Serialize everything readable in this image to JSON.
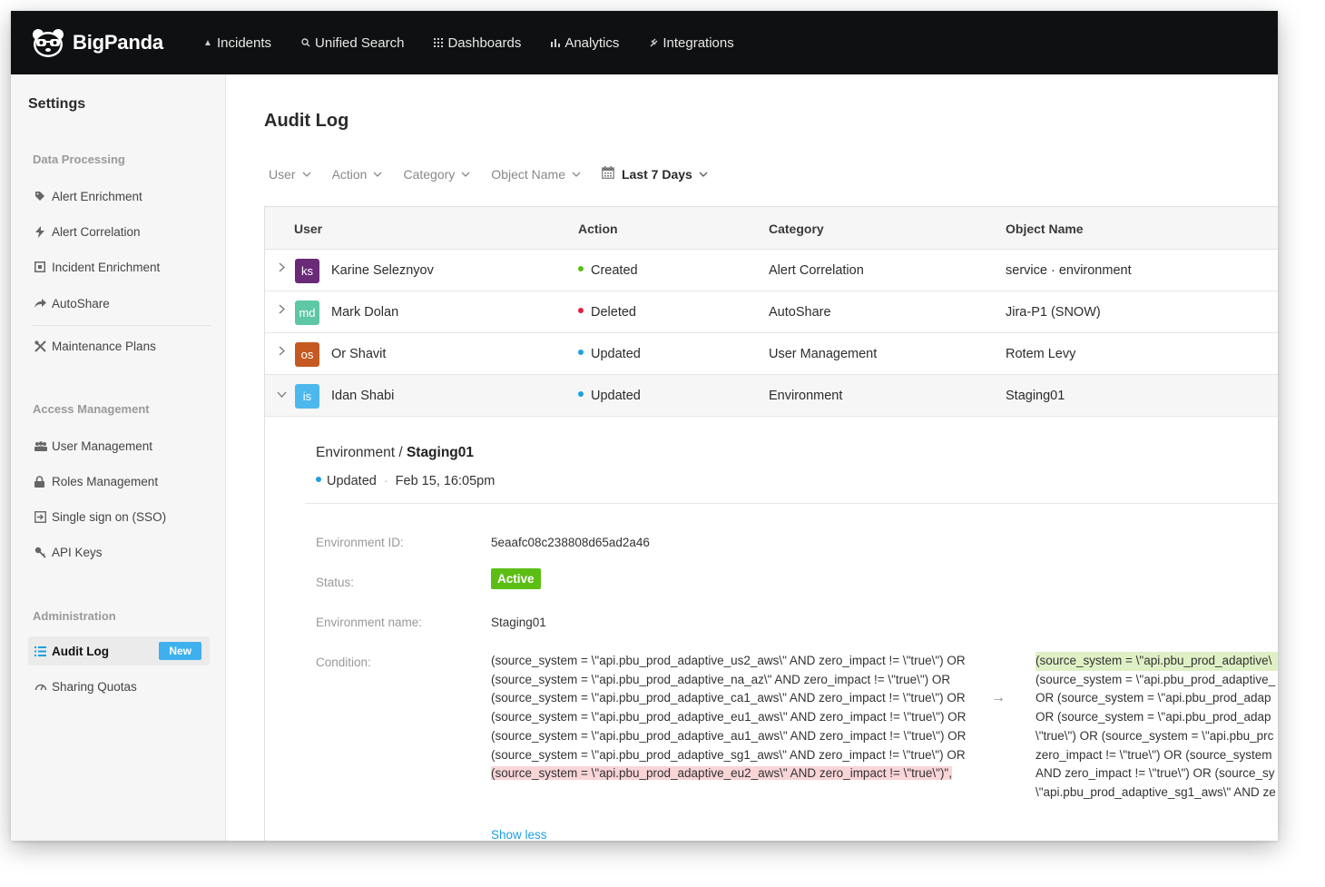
{
  "app": {
    "brand": "BigPanda"
  },
  "nav": [
    {
      "label": "Incidents",
      "icon": "triangle-icon"
    },
    {
      "label": "Unified Search",
      "icon": "search-icon"
    },
    {
      "label": "Dashboards",
      "icon": "grid-icon"
    },
    {
      "label": "Analytics",
      "icon": "bar-chart-icon"
    },
    {
      "label": "Integrations",
      "icon": "plug-icon"
    }
  ],
  "sidebar": {
    "title": "Settings",
    "sections": [
      {
        "label": "Data Processing",
        "items": [
          {
            "label": "Alert Enrichment",
            "icon": "tag-icon"
          },
          {
            "label": "Alert Correlation",
            "icon": "bolt-icon"
          },
          {
            "label": "Incident Enrichment",
            "icon": "square-dot-icon"
          },
          {
            "label": "AutoShare",
            "icon": "share-arrow-icon"
          },
          {
            "label": "Maintenance Plans",
            "icon": "tools-icon"
          }
        ]
      },
      {
        "label": "Access Management",
        "items": [
          {
            "label": "User Management",
            "icon": "users-icon"
          },
          {
            "label": "Roles Management",
            "icon": "lock-icon"
          },
          {
            "label": "Single sign on (SSO)",
            "icon": "sign-in-icon"
          },
          {
            "label": "API Keys",
            "icon": "key-icon"
          }
        ]
      },
      {
        "label": "Administration",
        "items": [
          {
            "label": "Audit Log",
            "icon": "list-icon",
            "active": true,
            "badge": "New"
          },
          {
            "label": "Sharing Quotas",
            "icon": "gauge-icon"
          }
        ]
      }
    ]
  },
  "page": {
    "title": "Audit Log"
  },
  "filters": {
    "user": "User",
    "action": "Action",
    "category": "Category",
    "object_name": "Object Name",
    "date": "Last 7 Days"
  },
  "table": {
    "columns": [
      "User",
      "Action",
      "Category",
      "Object Name"
    ],
    "rows": [
      {
        "initials": "ks",
        "avatar_color": "#6b2a78",
        "user": "Karine Seleznyov",
        "action": "Created",
        "action_color": "#5cbe15",
        "category": "Alert Correlation",
        "object": "service · environment"
      },
      {
        "initials": "md",
        "avatar_color": "#5dc7a6",
        "user": "Mark Dolan",
        "action": "Deleted",
        "action_color": "#e0213f",
        "category": "AutoShare",
        "object": "Jira-P1 (SNOW)"
      },
      {
        "initials": "os",
        "avatar_color": "#c45a22",
        "user": "Or Shavit",
        "action": "Updated",
        "action_color": "#1e9fe3",
        "category": "User Management",
        "object": "Rotem Levy"
      },
      {
        "initials": "is",
        "avatar_color": "#4cb8ee",
        "user": "Idan Shabi",
        "action": "Updated",
        "action_color": "#1e9fe3",
        "category": "Environment",
        "object": "Staging01"
      }
    ]
  },
  "detail": {
    "category": "Environment / ",
    "object": "Staging01",
    "action": "Updated",
    "date": "Feb 15, 16:05pm",
    "fields": {
      "env_id_label": "Environment ID:",
      "env_id": "5eaafc08c238808d65ad2a46",
      "status_label": "Status:",
      "status": "Active",
      "name_label": "Environment name:",
      "name": "Staging01",
      "condition_label": "Condition:"
    },
    "condition_old": "(source_system = \\\"api.pbu_prod_adaptive_us2_aws\\\" AND zero_impact != \\\"true\\\") OR (source_system = \\\"api.pbu_prod_adaptive_na_az\\\" AND zero_impact != \\\"true\\\") OR (source_system = \\\"api.pbu_prod_adaptive_ca1_aws\\\" AND zero_impact != \\\"true\\\") OR (source_system = \\\"api.pbu_prod_adaptive_eu1_aws\\\" AND zero_impact != \\\"true\\\") OR (source_system = \\\"api.pbu_prod_adaptive_au1_aws\\\" AND zero_impact != \\\"true\\\") OR (source_system = \\\"api.pbu_prod_adaptive_sg1_aws\\\" AND zero_impact != \\\"true\\\") OR",
    "condition_old_removed": "(source_system = \\\"api.pbu_prod_adaptive_eu2_aws\\\" AND zero_impact != \\\"true\\\")\",",
    "condition_new_lines": [
      "(source_system = \\\"api.pbu_prod_adaptive\\",
      "(source_system = \\\"api.pbu_prod_adaptive_",
      "OR (source_system = \\\"api.pbu_prod_adap",
      "OR (source_system = \\\"api.pbu_prod_adap",
      "\\\"true\\\") OR (source_system = \\\"api.pbu_prc",
      "zero_impact != \\\"true\\\") OR (source_system",
      "AND zero_impact != \\\"true\\\") OR (source_sy",
      "\\\"api.pbu_prod_adaptive_sg1_aws\\\" AND ze"
    ],
    "show_more": "Show less"
  }
}
